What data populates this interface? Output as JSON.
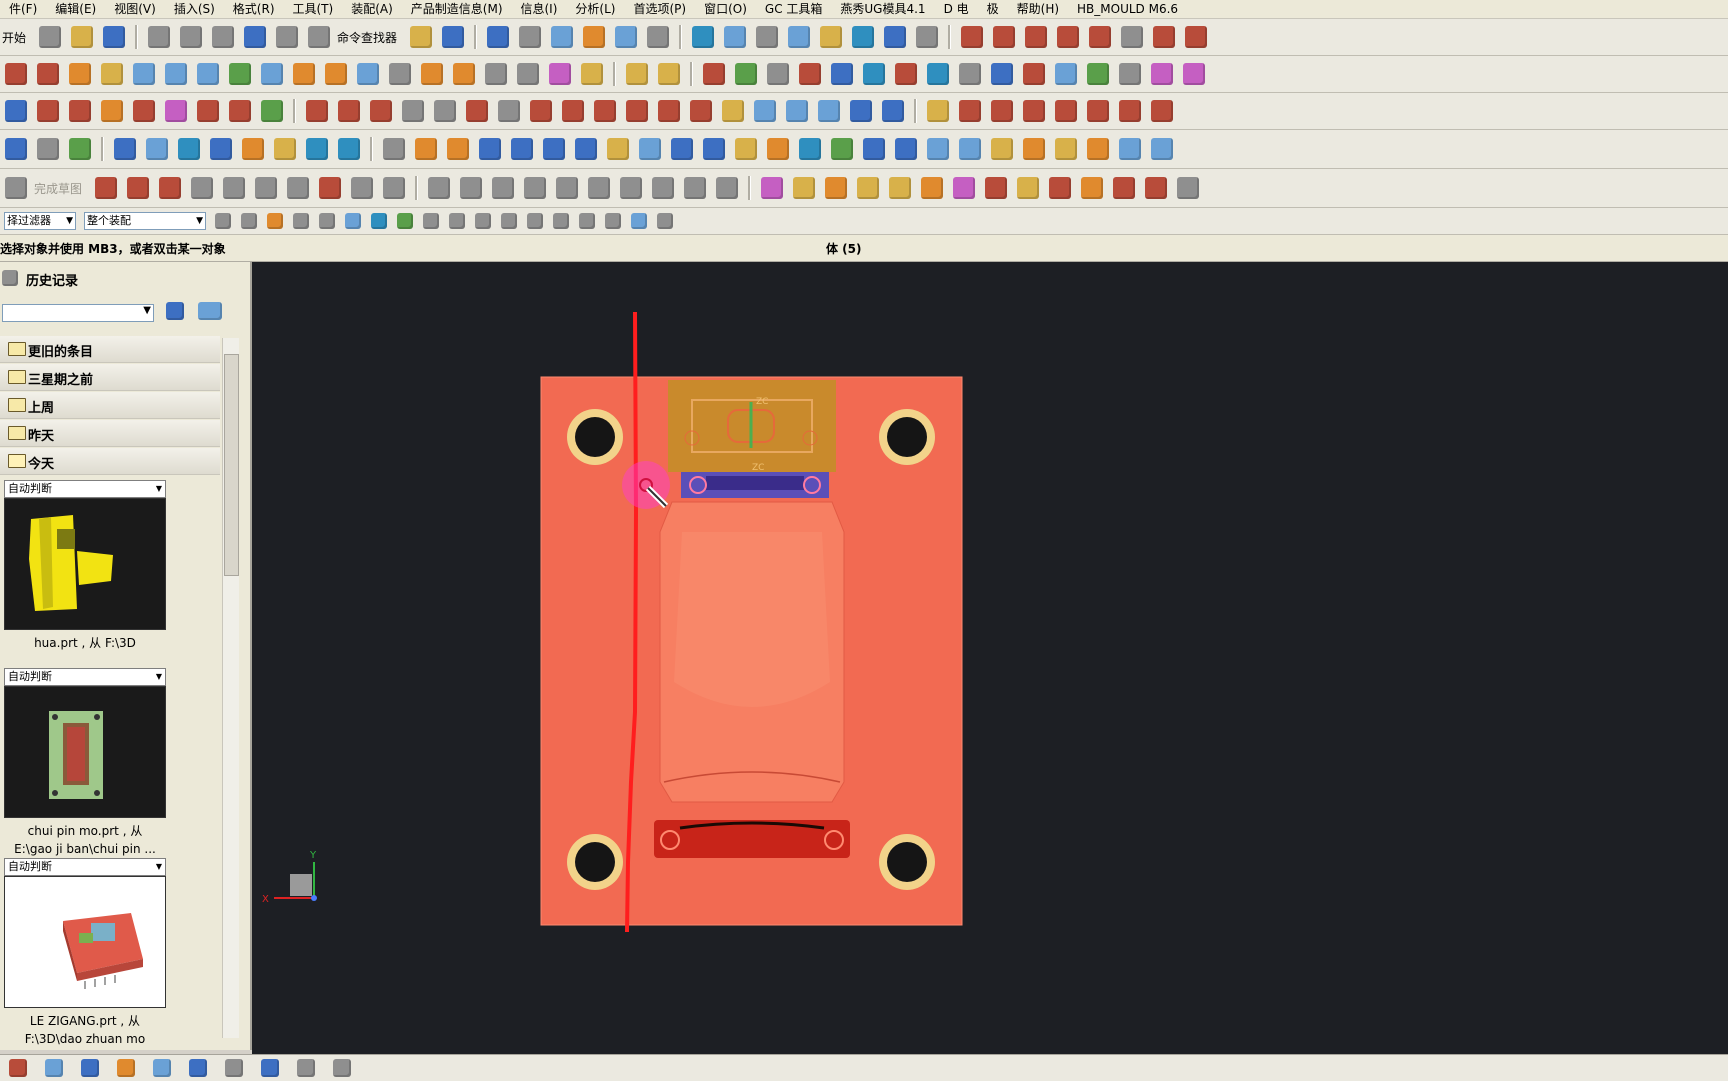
{
  "menu": [
    "件(F)",
    "编辑(E)",
    "视图(V)",
    "插入(S)",
    "格式(R)",
    "工具(T)",
    "装配(A)",
    "产品制造信息(M)",
    "信息(I)",
    "分析(L)",
    "首选项(P)",
    "窗口(O)",
    "GC 工具箱",
    "燕秀UG模具4.1",
    "D 电",
    "极",
    "帮助(H)",
    "HB_MOULD M6.6"
  ],
  "toolbar": {
    "start_label": "开始",
    "command_finder": "命令查找器",
    "sketch_finish": "完成草图",
    "filter_label": "择过滤器",
    "assembly_scope": "整个装配"
  },
  "status": {
    "prompt": "选择对象并使用 MB3，或者双击某一对象",
    "selection": "体 (5)"
  },
  "history": {
    "title": "历史记录",
    "groups": [
      "更旧的条目",
      "三星期之前",
      "上周",
      "昨天",
      "今天"
    ],
    "items": [
      {
        "dropdown": "自动判断",
        "caption1": "hua.prt , 从 F:\\3D",
        "caption2": ""
      },
      {
        "dropdown": "自动判断",
        "caption1": "chui pin mo.prt , 从",
        "caption2": "E:\\gao ji ban\\chui pin ..."
      },
      {
        "dropdown": "自动判断",
        "caption1": "LE  ZIGANG.prt , 从",
        "caption2": "F:\\3D\\dao zhuan mo"
      }
    ]
  },
  "viewport": {
    "background": "#1d1f24",
    "plate_color": "#f26a52",
    "trace_color": "#ff1e1e",
    "axes": {
      "x": "X",
      "y": "Y"
    },
    "sketch_labels": [
      "ZC",
      "ZC"
    ]
  },
  "colors": {
    "chrome": "#ece9d8",
    "gold_insert": "#c98a2c",
    "blue_slide": "#5b4fb8",
    "red_block": "#c82419"
  }
}
